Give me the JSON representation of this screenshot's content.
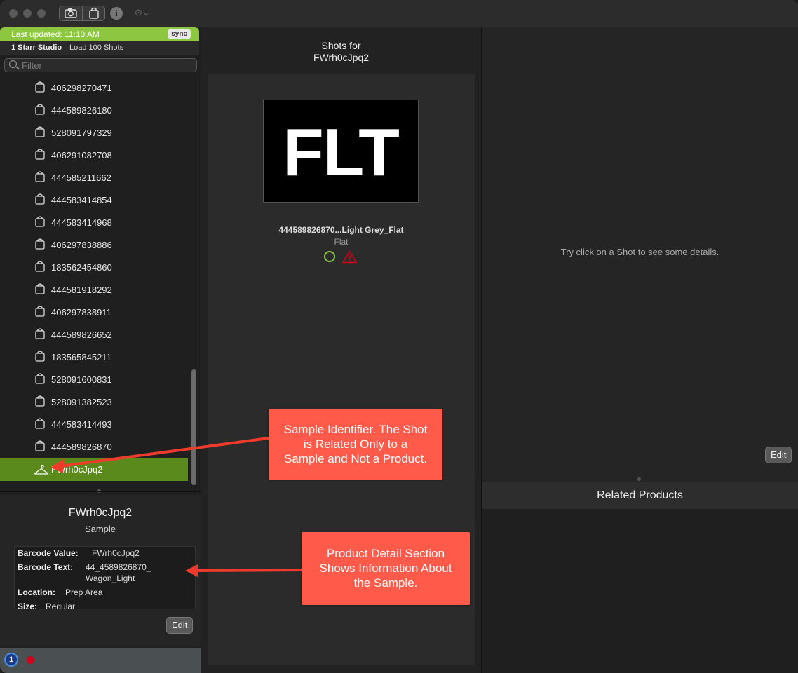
{
  "toolbar": {
    "info": "i"
  },
  "status": {
    "last_updated": "Last updated: 11:10 AM",
    "sync": "sync"
  },
  "studio": {
    "name": "1 Starr Studio",
    "load": "Load 100 Shots"
  },
  "filter": {
    "placeholder": "Filter"
  },
  "list": {
    "items": [
      "406298270471",
      "444589826180",
      "528091797329",
      "406291082708",
      "444585211662",
      "444583414854",
      "444583414968",
      "406297838886",
      "183562454860",
      "444581918292",
      "406297838911",
      "444589826652",
      "183565845211",
      "528091600831",
      "528091382523",
      "444583414493",
      "444589826870"
    ],
    "selected": "FWrh0cJpq2"
  },
  "detail": {
    "title": "FWrh0cJpq2",
    "subtitle": "Sample",
    "fields": {
      "barcode_value_k": "Barcode Value:",
      "barcode_value_v": "FWrh0cJpq2",
      "barcode_text_k": "Barcode Text:",
      "barcode_text_v1": "44_4589826870_",
      "barcode_text_v2": "Wagon_Light",
      "location_k": "Location:",
      "location_v": "Prep Area",
      "size_k": "Size:",
      "size_v": "Regular"
    },
    "edit": "Edit"
  },
  "footer": {
    "badge": "1"
  },
  "middle": {
    "title_line1": "Shots for",
    "title_line2": "FWrh0cJpq2",
    "shot": {
      "thumb_text": "FLT",
      "name": "444589826870...Light Grey_Flat",
      "type": "Flat"
    }
  },
  "right": {
    "hint": "Try click on a Shot to see some details.",
    "edit": "Edit",
    "related": "Related Products"
  },
  "annotations": {
    "sample_id_1": "Sample Identifier. The Shot",
    "sample_id_2": "is Related Only to a",
    "sample_id_3": "Sample and Not a Product.",
    "detail_1": "Product Detail Section",
    "detail_2": "Shows Information About",
    "detail_3": "the Sample."
  },
  "colors": {
    "accent_green": "#8dc63f",
    "selection_green": "#5a8a1c",
    "callout_red": "#ff5a4a",
    "warning_red": "#d0021b"
  }
}
